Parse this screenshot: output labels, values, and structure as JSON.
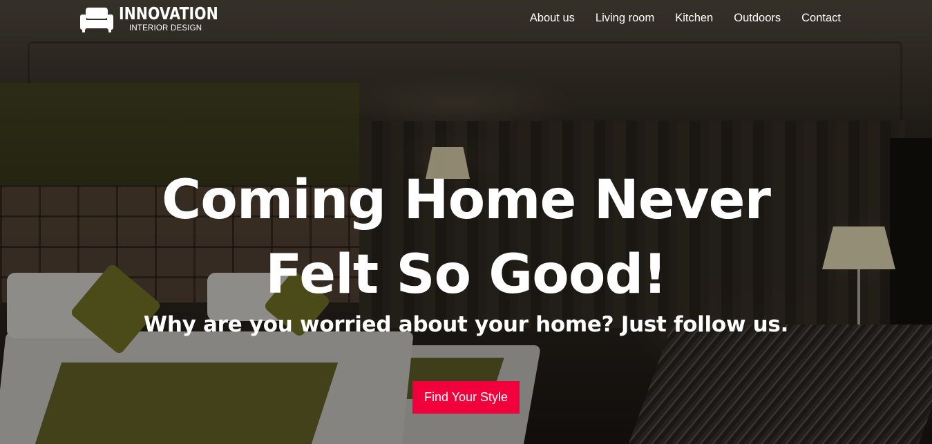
{
  "brand": {
    "name": "INNOVATION",
    "tagline": "INTERIOR DESIGN",
    "logo_icon": "sofa-icon"
  },
  "nav": {
    "items": [
      {
        "label": "About us"
      },
      {
        "label": "Living room"
      },
      {
        "label": "Kitchen"
      },
      {
        "label": "Outdoors"
      },
      {
        "label": "Contact"
      }
    ]
  },
  "hero": {
    "headline_line1": "Coming Home Never",
    "headline_line2": "Felt So Good!",
    "subheadline": "Why are you worried about your home? Just follow us.",
    "cta_label": "Find Your Style"
  },
  "colors": {
    "accent": "#f2003c",
    "text": "#ffffff"
  }
}
